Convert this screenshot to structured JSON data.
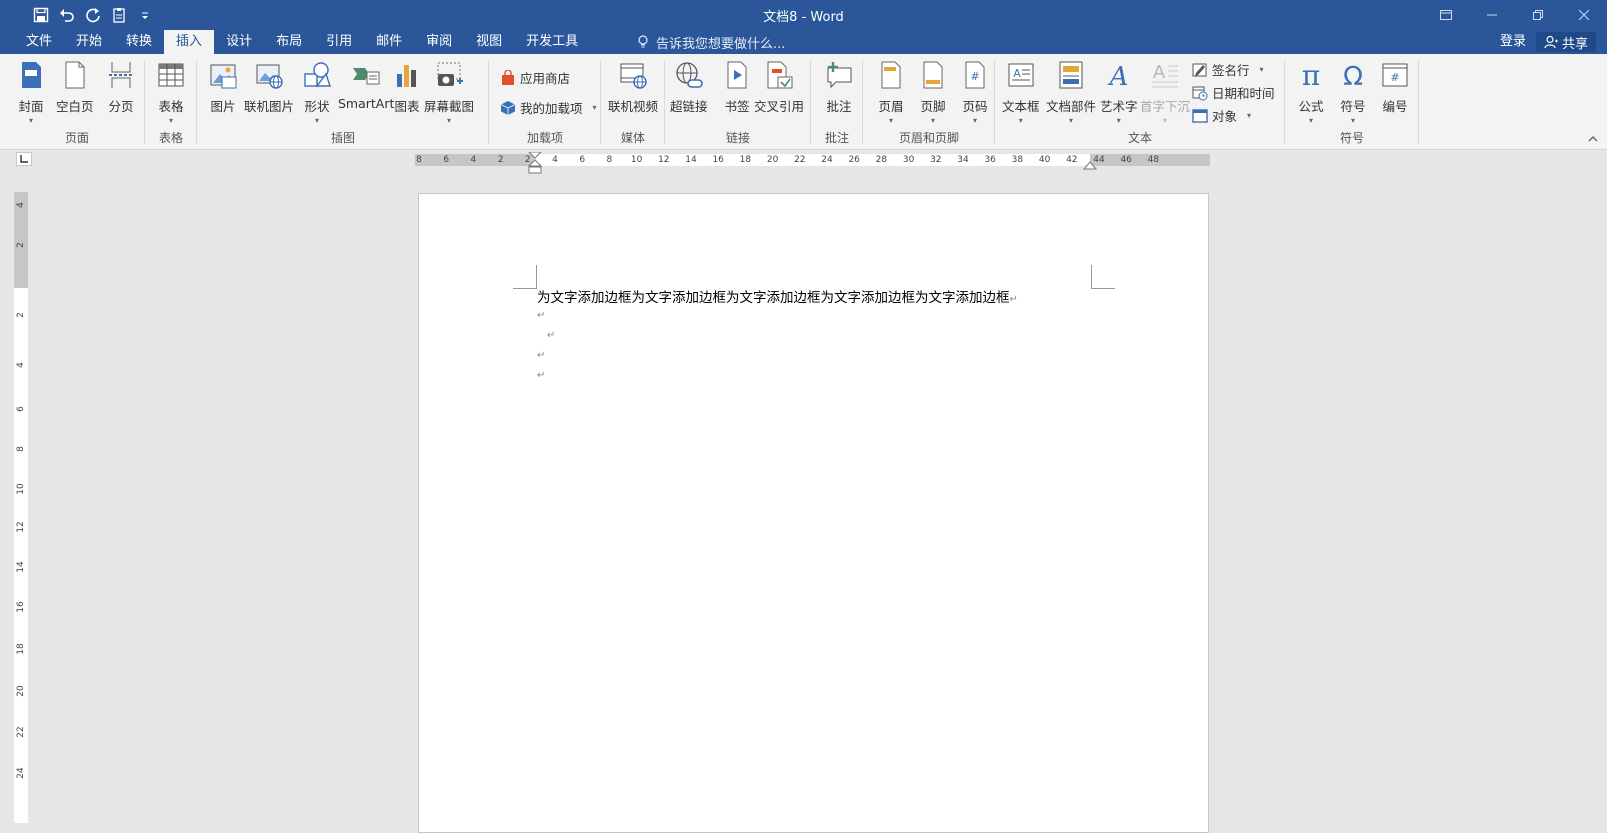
{
  "app": {
    "title": "文档8 - Word"
  },
  "tabs": [
    {
      "label": "文件"
    },
    {
      "label": "开始"
    },
    {
      "label": "转换"
    },
    {
      "label": "插入",
      "active": true
    },
    {
      "label": "设计"
    },
    {
      "label": "布局"
    },
    {
      "label": "引用"
    },
    {
      "label": "邮件"
    },
    {
      "label": "审阅"
    },
    {
      "label": "视图"
    },
    {
      "label": "开发工具"
    }
  ],
  "tellme": {
    "text": "告诉我您想要做什么..."
  },
  "account": {
    "signin": "登录",
    "share": "共享"
  },
  "ribbon": {
    "pages": {
      "label": "页面",
      "cover": "封面",
      "blank": "空白页",
      "break": "分页"
    },
    "tables": {
      "label": "表格",
      "table": "表格"
    },
    "illustrations": {
      "label": "插图",
      "picture": "图片",
      "online_picture": "联机图片",
      "shapes": "形状",
      "smartart": "SmartArt",
      "chart": "图表",
      "screenshot": "屏幕截图"
    },
    "addins": {
      "label": "加载项",
      "store": "应用商店",
      "my_addins": "我的加载项"
    },
    "media": {
      "label": "媒体",
      "online_video": "联机视频"
    },
    "links": {
      "label": "链接",
      "hyperlink": "超链接",
      "bookmark": "书签",
      "cross_ref": "交叉引用"
    },
    "comments": {
      "label": "批注",
      "comment": "批注"
    },
    "header_footer": {
      "label": "页眉和页脚",
      "header": "页眉",
      "footer": "页脚",
      "page_number": "页码"
    },
    "text": {
      "label": "文本",
      "textbox": "文本框",
      "quick_parts": "文档部件",
      "wordart": "艺术字",
      "dropcap": "首字下沉",
      "signature": "签名行",
      "datetime": "日期和时间",
      "object": "对象"
    },
    "symbols": {
      "label": "符号",
      "equation": "公式",
      "symbol": "符号",
      "numbering": "编号"
    }
  },
  "hruler_ticks": [
    "8",
    "6",
    "4",
    "2",
    "2",
    "4",
    "6",
    "8",
    "10",
    "12",
    "14",
    "16",
    "18",
    "20",
    "22",
    "24",
    "26",
    "28",
    "30",
    "32",
    "34",
    "36",
    "38",
    "40",
    "42",
    "44",
    "46",
    "48"
  ],
  "vruler_ticks": [
    "4",
    "2",
    "2",
    "4",
    "6",
    "8",
    "10",
    "12",
    "14",
    "16",
    "18",
    "20",
    "22",
    "24"
  ],
  "document": {
    "line1": "为文字添加边框为文字添加边框为文字添加边框为文字添加边框为文字添加边框",
    "pilcrow": "↵"
  }
}
